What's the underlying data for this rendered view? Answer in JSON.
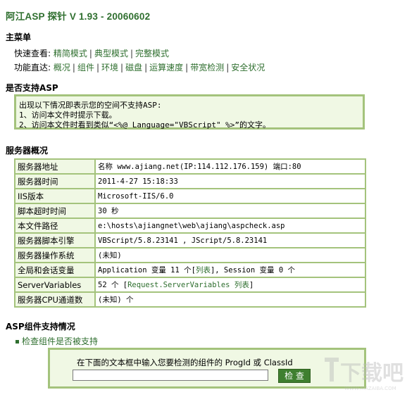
{
  "header": {
    "title": "阿江ASP 探针 V 1.93 - 20060602"
  },
  "menu": {
    "heading": "主菜单",
    "quick_label": "快速查看:",
    "quick_links": [
      "精简模式",
      "典型模式",
      "完整模式"
    ],
    "func_label": "功能直达:",
    "func_links": [
      "概况",
      "组件",
      "环境",
      "磁盘",
      "运算速度",
      "带宽检测",
      "安全状况"
    ]
  },
  "asp_support": {
    "heading": "是否支持ASP",
    "lines": [
      "出现以下情况即表示您的空间不支持ASP:",
      "1、访问本文件时提示下载。",
      "2、访问本文件时看到类似“<%@ Language=\"VBScript\" %>”的文字。"
    ]
  },
  "server": {
    "heading": "服务器概况",
    "rows": [
      {
        "key": "服务器地址",
        "value": "名称 www.ajiang.net(IP:114.112.176.159) 端口:80"
      },
      {
        "key": "服务器时间",
        "value": "2011-4-27 15:18:33"
      },
      {
        "key": "IIS版本",
        "value": "Microsoft-IIS/6.0"
      },
      {
        "key": "脚本超时时间",
        "value": "30 秒"
      },
      {
        "key": "本文件路径",
        "value": "e:\\hosts\\ajiangnet\\web\\ajiang\\aspcheck.asp"
      },
      {
        "key": "服务器脚本引擎",
        "value": "VBScript/5.8.23141 , JScript/5.8.23141"
      },
      {
        "key": "服务器操作系统",
        "value": "(未知)"
      },
      {
        "key": "全局和会话变量",
        "value": "Application 变量 11 个[",
        "link": "列表",
        "tail": "], Session 变量 0 个"
      },
      {
        "key": "ServerVariables",
        "value": "52 个 [",
        "link": "Request.ServerVariables 列表",
        "tail": "]"
      },
      {
        "key": "服务器CPU通道数",
        "value": "(未知) 个"
      }
    ]
  },
  "components": {
    "heading": "ASP组件支持情况",
    "check_link": "检查组件是否被支持",
    "prompt": "在下面的文本框中输入您要检测的组件的 ProgId 或 ClassId",
    "input_value": "",
    "button": "检 查"
  },
  "watermark": {
    "text": "下载吧",
    "sub": "WWW.XIAZAIBA.COM"
  },
  "colors": {
    "accent": "#2f6f2f",
    "border": "#a4c37c",
    "panel_bg": "#f0f8e4"
  }
}
